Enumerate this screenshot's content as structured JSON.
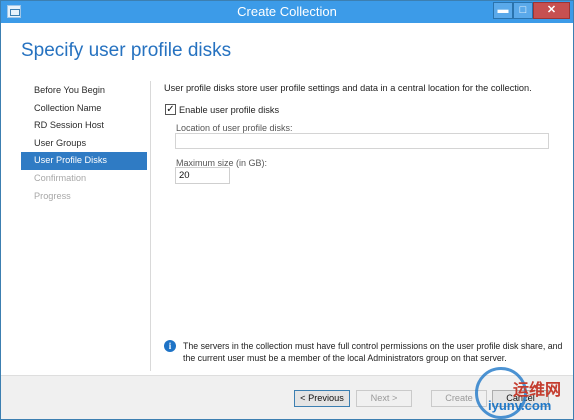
{
  "window": {
    "title": "Create Collection",
    "min_glyph": "▬",
    "max_glyph": "□",
    "close_glyph": "✕"
  },
  "header": {
    "page_title": "Specify user profile disks"
  },
  "nav": {
    "items": [
      {
        "label": "Before You Begin",
        "state": "normal"
      },
      {
        "label": "Collection Name",
        "state": "normal"
      },
      {
        "label": "RD Session Host",
        "state": "normal"
      },
      {
        "label": "User Groups",
        "state": "normal"
      },
      {
        "label": "User Profile Disks",
        "state": "active"
      },
      {
        "label": "Confirmation",
        "state": "disabled"
      },
      {
        "label": "Progress",
        "state": "disabled"
      }
    ]
  },
  "main": {
    "description": "User profile disks store user profile settings and data in a central location for the collection.",
    "enable_checkbox": {
      "label": "Enable user profile disks",
      "checked": true,
      "glyph": "✓"
    },
    "location": {
      "label": "Location of user profile disks:",
      "value": ""
    },
    "max_size": {
      "label": "Maximum size (in GB):",
      "value": "20"
    },
    "info": {
      "icon_glyph": "i",
      "text": "The servers in the collection must have full control permissions on the user profile disk share, and the current user must be a member of the local Administrators group on that server."
    }
  },
  "footer": {
    "previous_label": "< Previous",
    "next_label": "Next >",
    "create_label": "Create",
    "cancel_label": "Cancel"
  },
  "watermark": {
    "text1": "运维网",
    "text2": "iyunv.com"
  },
  "colors": {
    "accent": "#2f7bc4",
    "titlebar": "#3c9be8",
    "close": "#c75050"
  }
}
